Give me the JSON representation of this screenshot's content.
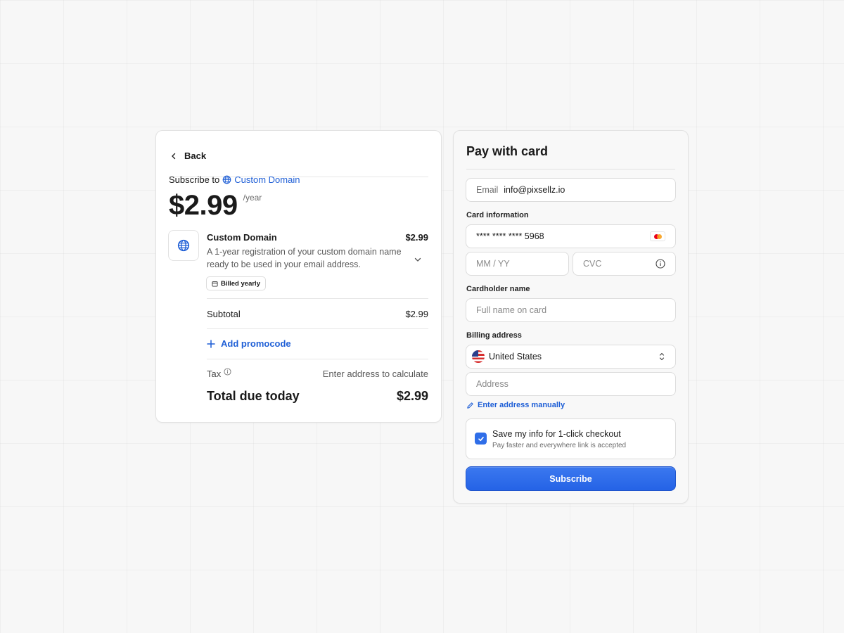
{
  "colors": {
    "accent": "#1f5fd6",
    "button": "#2563e6",
    "card_bg": "#ffffff"
  },
  "summary": {
    "back_label": "Back",
    "subscribe_prefix": "Subscribe to",
    "product_name": "Custom Domain",
    "price": "$2.99",
    "period": "/year",
    "item": {
      "icon": "globe-icon",
      "name": "Custom Domain",
      "price": "$2.99",
      "description": "A 1-year registration of your custom domain name ready to be used in your email address.",
      "badge": "Billed yearly"
    },
    "subtotal_label": "Subtotal",
    "subtotal_value": "$2.99",
    "promo_label": "Add promocode",
    "tax_label": "Tax",
    "tax_value": "Enter address to calculate",
    "total_label": "Total due today",
    "total_value": "$2.99"
  },
  "payment": {
    "title": "Pay with card",
    "email_label": "Email",
    "email_value": "info@pixsellz.io",
    "card_info_label": "Card information",
    "card_number": "**** **** **** 5968",
    "card_brand": "mastercard-icon",
    "expiry_placeholder": "MM / YY",
    "cvc_placeholder": "CVC",
    "cardholder_label": "Cardholder name",
    "cardholder_placeholder": "Full name on card",
    "billing_label": "Billing address",
    "country": "United States",
    "address_placeholder": "Address",
    "manual_link": "Enter address manually",
    "save_title": "Save my info for 1-click checkout",
    "save_subtitle": "Pay faster and everywhere link is accepted",
    "save_checked": true,
    "submit_label": "Subscribe"
  }
}
